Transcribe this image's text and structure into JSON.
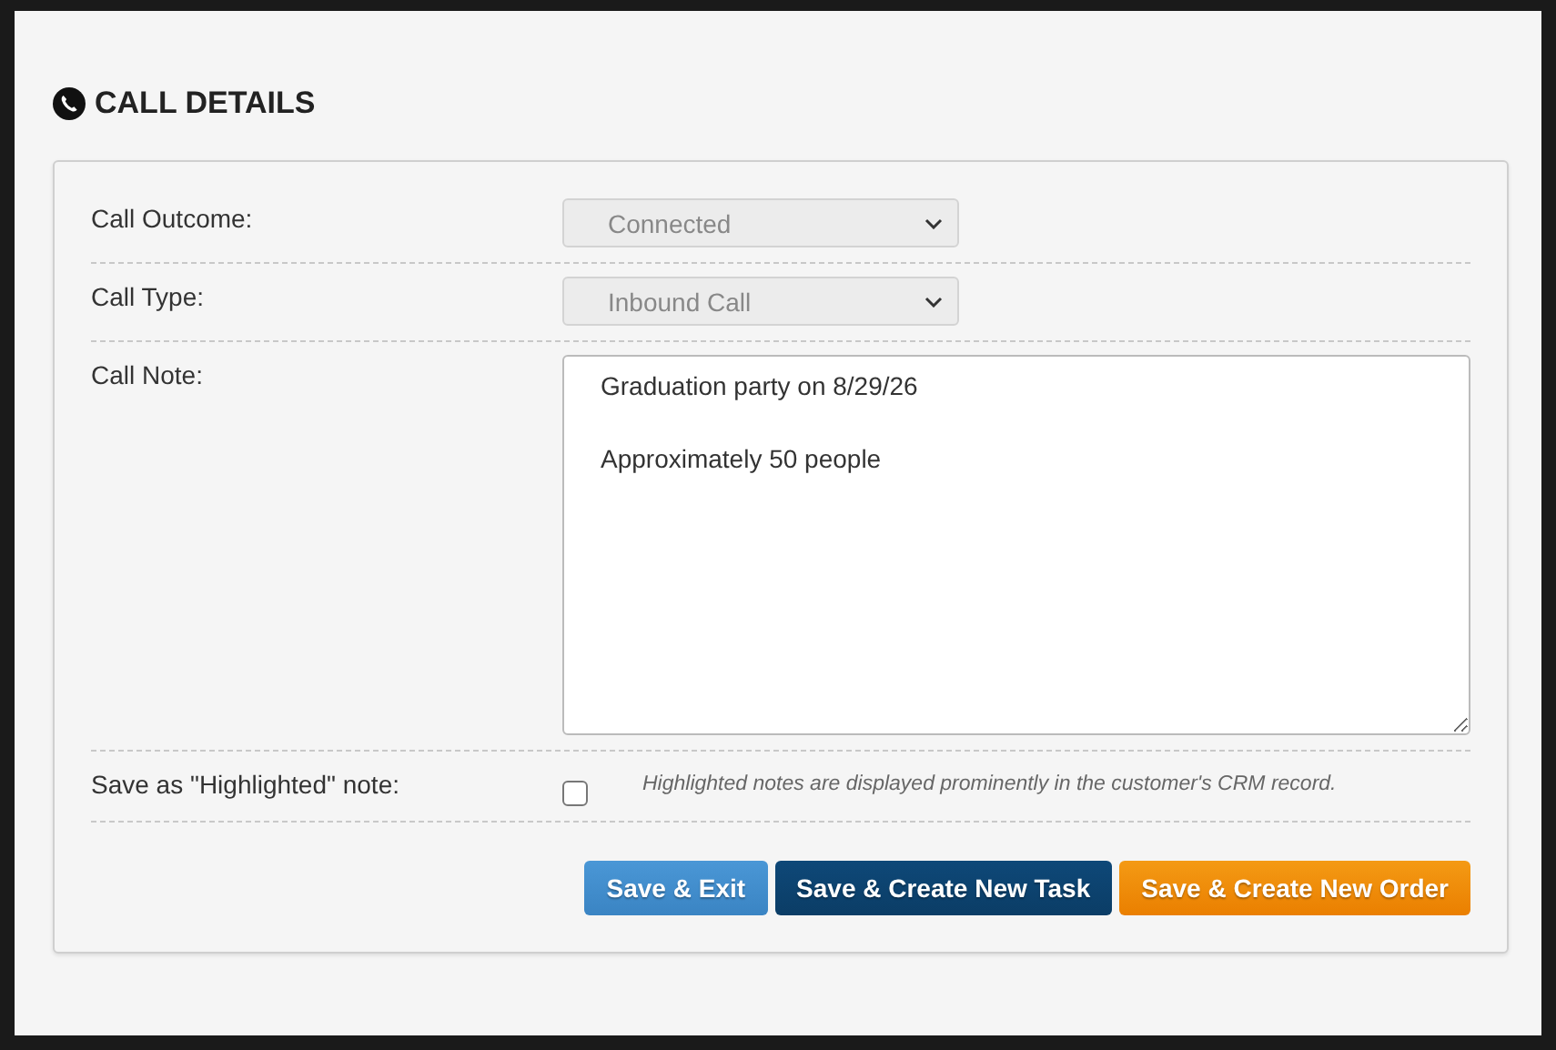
{
  "section": {
    "title": "CALL DETAILS"
  },
  "rows": [
    {
      "kind": "select",
      "label": "Call Outcome:",
      "value": "Connected",
      "disabled": true
    },
    {
      "kind": "select",
      "label": "Call Type:",
      "value": "Inbound Call",
      "disabled": true
    },
    {
      "kind": "textarea",
      "label": "Call Note:",
      "value": "Graduation party on 8/29/26\n\nApproximately 50 people"
    },
    {
      "kind": "checkbox",
      "label": "Save as \"Highlighted\" note:",
      "checked": false,
      "hint": "Highlighted notes are displayed prominently in the customer's CRM record."
    }
  ],
  "buttons": [
    {
      "label": "Save & Exit",
      "kind": "light"
    },
    {
      "label": "Save & Create New Task",
      "kind": "dark"
    },
    {
      "label": "Save & Create New Order",
      "kind": "orange"
    }
  ]
}
